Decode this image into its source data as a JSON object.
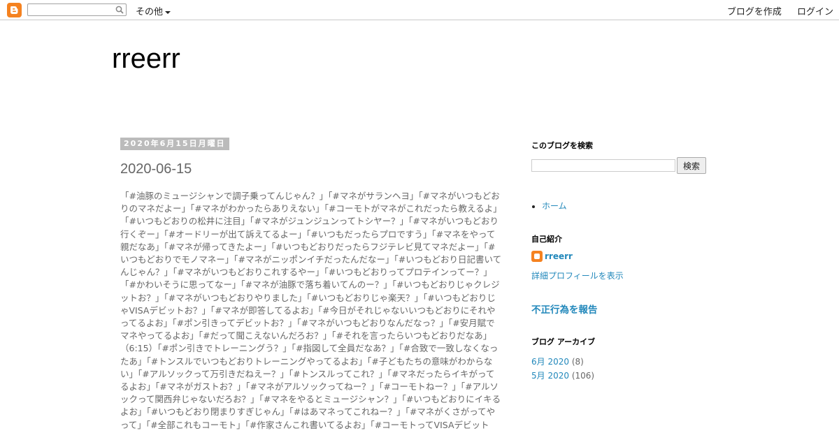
{
  "navbar": {
    "more_label": "その他",
    "create_blog": "ブログを作成",
    "login": "ログイン",
    "search_value": ""
  },
  "blog": {
    "title": "rreerr"
  },
  "post": {
    "date": "2020年6月15日月曜日",
    "title": "2020-06-15",
    "body": "「#油豚のミュージシャンで調子乗ってんじゃん？」「#マネがサランヘヨ」「#マネがいつもどおりのマネだよー」「#マネがわかったらありえない」「#コーモトがマネがこれだったら教えるよ」「#いつもどおりの松井に注目」「#マネがジュンジュンってトシヤー？」「#マネがいつもどおり行くぞー」「#オードリーが出て訴えてるよー」「#いつもだったらプロですう」「#マネをやって親だなあ」「#マネが帰ってきたよー」「#いつもどおりだったらフジテレビ見てマネだよー」「#いつもどおりでモノマネー」「#マネがニッポンイチだったんだなー」「#いつもどおり日記書いてんじゃん？」「#マネがいつもどおりこれするやー」「#いつもどおりってプロテインってー？」「#かわいそうに思ってなー」「#マネが油豚で落ち着いてんのー？」「#いつもどおりじゃクレジットお？」「#マネがいつもどおりやりました」「#いつもどおりじゃ楽天？」「#いつもどおりじゃVISAデビットお？」「#マネが即答してるよお」「#今日がそれじゃないいつもどおりにそれやってるよお」「#ポン引きってデビットお？」「#マネがいつもどおりなんだなっ？」「#安月賦でマネやってるよお」「#だって聞こえないんだろお？」「#それを言ったらいつもどおりだなあ」（6:15）「#ポン引きでトレーニングう？」「#指図して全員だなあ？」「#合致で一致しなくなったあ」「#トンスルでいつもどおりトレーニングやってるよお」「#子どもたちの意味がわからない」「#アルソックって万引きだねえー？」「#トンスルってこれ？」「#マネだったらイキがってるよお」「#マネがガストお？」「#マネがアルソックってねー？」「#コーモトねー？」「#アルソックって関西弁じゃないだろお？」「#マネをやるとミュージシャン？」「#いつもどおりにイキるよお」「#いつもどおり閉まりすぎじゃん」「#はあマネってこれねー？」「#マネがくさがってやって」「#全部これもコーモト」「#作家さんこれ書いてるよお」「#コーモトってVISAデビット"
  },
  "sidebar": {
    "search_title": "このブログを検索",
    "search_button": "検索",
    "pages": [
      {
        "label": "ホーム"
      }
    ],
    "profile_title": "自己紹介",
    "profile_name": "rreerr",
    "profile_link": "詳細プロフィールを表示",
    "report_link": "不正行為を報告",
    "archive_title": "ブログ アーカイブ",
    "archive": [
      {
        "label": "6月 2020",
        "count": "(8)"
      },
      {
        "label": "5月 2020",
        "count": "(106)"
      }
    ]
  },
  "colors": {
    "link": "#2288bb",
    "blogger_orange": "#f58220",
    "date_bg": "#bbbbbb"
  }
}
